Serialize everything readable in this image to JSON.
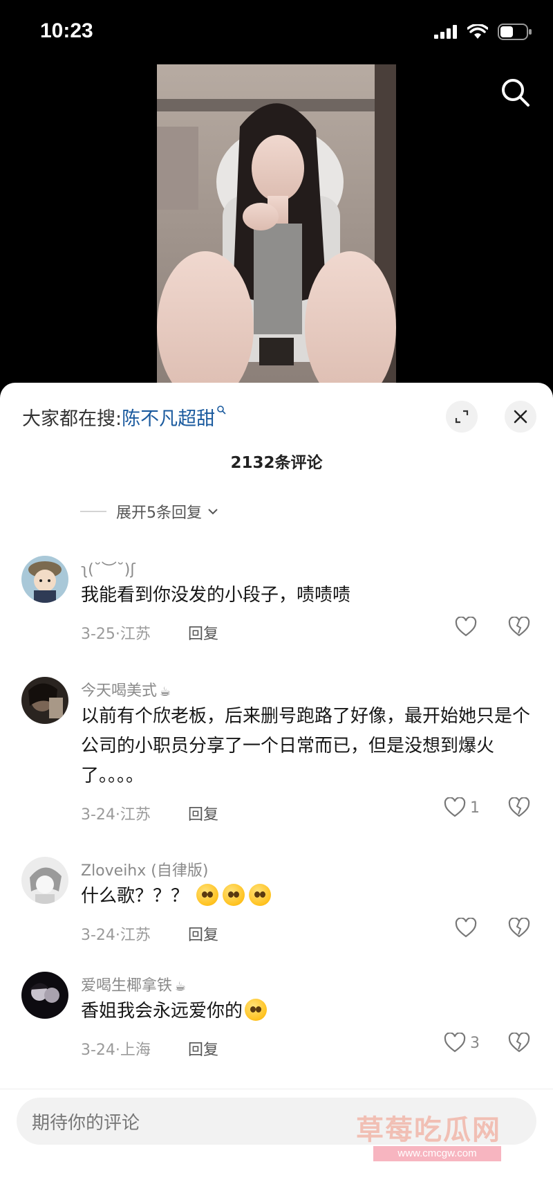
{
  "status_bar": {
    "time": "10:23"
  },
  "sheet": {
    "trending_prefix": "大家都在搜:",
    "trending_keyword": "陈不凡超甜",
    "comment_count": "2132条评论",
    "expand_replies": "展开5条回复"
  },
  "comments": [
    {
      "user": "ʅ(˘︶˘)ʃ",
      "text": "我能看到你没发的小段子，啧啧啧",
      "date_location": "3-25·江苏",
      "reply_label": "回复",
      "likes": ""
    },
    {
      "user": "今天喝美式",
      "text": "以前有个欣老板，后来删号跑路了好像，最开始她只是个公司的小职员分享了一个日常而已，但是没想到爆火了。。。。",
      "date_location": "3-24·江苏",
      "reply_label": "回复",
      "likes": "1"
    },
    {
      "user": "Zloveihx (自律版)",
      "text": "什么歌？？？",
      "date_location": "3-24·江苏",
      "reply_label": "回复",
      "likes": ""
    },
    {
      "user": "爱喝生椰拿铁",
      "text": "香姐我会永远爱你的",
      "date_location": "3-24·上海",
      "reply_label": "回复",
      "likes": "3"
    }
  ],
  "input": {
    "placeholder": "期待你的评论"
  },
  "watermark": {
    "text": "草莓吃瓜网",
    "url": "www.cmcgw.com"
  },
  "icons": {
    "search": "search-icon",
    "expand": "expand-icon",
    "close": "close-icon",
    "like": "heart-icon",
    "dislike": "broken-heart-icon"
  }
}
